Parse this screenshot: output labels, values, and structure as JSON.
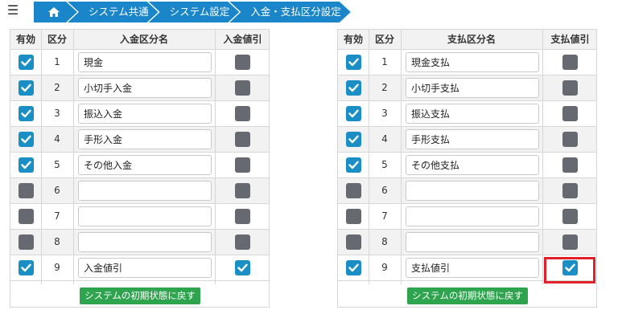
{
  "menu_icon": "hamburger-icon",
  "breadcrumb": {
    "home_icon": "home-icon",
    "items": [
      "システム共通",
      "システム設定",
      "入金・支払区分設定"
    ]
  },
  "colors": {
    "accent": "#1a85c8",
    "checked": "#1a8fc6",
    "unchecked": "#666a70",
    "reset_button": "#2ea44f",
    "highlight": "#e0202a"
  },
  "deposit": {
    "headers": {
      "enabled": "有効",
      "category": "区分",
      "name": "入金区分名",
      "discount": "入金値引"
    },
    "rows": [
      {
        "num": "1",
        "enabled": true,
        "name": "現金",
        "discount": false
      },
      {
        "num": "2",
        "enabled": true,
        "name": "小切手入金",
        "discount": false
      },
      {
        "num": "3",
        "enabled": true,
        "name": "振込入金",
        "discount": false
      },
      {
        "num": "4",
        "enabled": true,
        "name": "手形入金",
        "discount": false
      },
      {
        "num": "5",
        "enabled": true,
        "name": "その他入金",
        "discount": false
      },
      {
        "num": "6",
        "enabled": false,
        "name": "",
        "discount": false
      },
      {
        "num": "7",
        "enabled": false,
        "name": "",
        "discount": false
      },
      {
        "num": "8",
        "enabled": false,
        "name": "",
        "discount": false
      },
      {
        "num": "9",
        "enabled": true,
        "name": "入金値引",
        "discount": true
      }
    ],
    "reset_label": "システムの初期状態に戻す"
  },
  "payment": {
    "headers": {
      "enabled": "有効",
      "category": "区分",
      "name": "支払区分名",
      "discount": "支払値引"
    },
    "rows": [
      {
        "num": "1",
        "enabled": true,
        "name": "現金支払",
        "discount": false
      },
      {
        "num": "2",
        "enabled": true,
        "name": "小切手支払",
        "discount": false
      },
      {
        "num": "3",
        "enabled": true,
        "name": "振込支払",
        "discount": false
      },
      {
        "num": "4",
        "enabled": true,
        "name": "手形支払",
        "discount": false
      },
      {
        "num": "5",
        "enabled": true,
        "name": "その他支払",
        "discount": false
      },
      {
        "num": "6",
        "enabled": false,
        "name": "",
        "discount": false
      },
      {
        "num": "7",
        "enabled": false,
        "name": "",
        "discount": false
      },
      {
        "num": "8",
        "enabled": false,
        "name": "",
        "discount": false
      },
      {
        "num": "9",
        "enabled": true,
        "name": "支払値引",
        "discount": true
      }
    ],
    "reset_label": "システムの初期状態に戻す"
  }
}
